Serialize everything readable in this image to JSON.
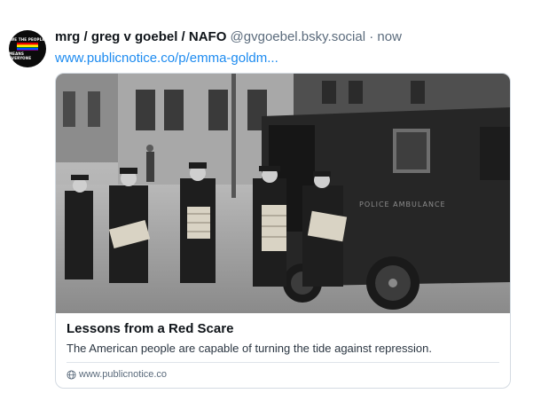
{
  "post": {
    "author": {
      "display_name": "mrg / greg v goebel / NAFO",
      "handle": "@gvgoebel.bsky.social",
      "avatar_text_top": "WE THE PEOPLE",
      "avatar_text_bottom": "MEANS EVERYONE",
      "avatar_flag_colors": [
        "#e40303",
        "#ff8c00",
        "#ffed00",
        "#008026",
        "#004dff",
        "#750787"
      ]
    },
    "separator": "·",
    "timestamp": "now",
    "link_text": "www.publicnotice.co/p/emma-goldm..."
  },
  "link_card": {
    "image_icon": "archival-photo-police-ambulance",
    "image_text": "POLICE AMBULANCE",
    "title": "Lessons from a Red Scare",
    "description": "The American people are capable of turning the tide against repression.",
    "domain_icon": "globe-icon",
    "domain": "www.publicnotice.co"
  },
  "colors": {
    "link": "#1d8bf0",
    "muted": "#5b6b7c",
    "text": "#0f1419",
    "card_border": "#d4dbe2"
  }
}
